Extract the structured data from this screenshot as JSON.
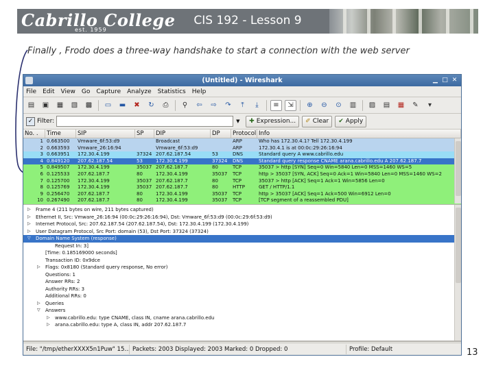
{
  "slide": {
    "logo_text": "Cabrillo College",
    "logo_est": "est. 1959",
    "title": "CIS 192 - Lesson 9",
    "caption": "Finally , Frodo does a three-way handshake to start a connection with the web server",
    "page_number": "13"
  },
  "window": {
    "title": "(Untitled) - Wireshark"
  },
  "menu": [
    "File",
    "Edit",
    "View",
    "Go",
    "Capture",
    "Analyze",
    "Statistics",
    "Help"
  ],
  "toolbar_icons": [
    "interfaces-icon",
    "start-icon",
    "stop-icon",
    "restart-icon",
    "options-icon",
    "open-icon",
    "save-icon",
    "close-icon",
    "reload-icon",
    "print-icon",
    "find-icon",
    "back-icon",
    "forward-icon",
    "goto-icon",
    "top-icon",
    "bottom-icon",
    "colorize-icon",
    "autoscroll-icon",
    "zoom-in-icon",
    "zoom-out-icon",
    "zoom-normal-icon",
    "resize-columns-icon",
    "capture-filters-icon",
    "display-filters-icon",
    "coloring-rules-icon",
    "preferences-icon",
    "help-icon"
  ],
  "filter": {
    "label": "Filter:",
    "value": "",
    "expression_label": "Expression...",
    "clear_label": "Clear",
    "apply_label": "Apply"
  },
  "packet_list": {
    "columns": [
      "No. .",
      "Time",
      "SIP",
      "SP",
      "DIP",
      "DP",
      "Protocol",
      "Info"
    ],
    "selected_index": 3,
    "rows": [
      {
        "no": "1",
        "time": "0.663500",
        "src": "Vmware_6f:53:d9",
        "sp": "",
        "dip": "Broadcast",
        "dp": "",
        "proto": "ARP",
        "info": "Who has 172.30.4.1? Tell 172.30.4.199",
        "color": "#b9d4ee"
      },
      {
        "no": "2",
        "time": "0.663593",
        "src": "Vmware_26:16:94",
        "sp": "",
        "dip": "Vmware_6f:53:d9",
        "dp": "",
        "proto": "ARP",
        "info": "172.30.4.1 is at 00:0c:29:26:16:94",
        "color": "#b9d4ee"
      },
      {
        "no": "3",
        "time": "0.663951",
        "src": "172.30.4.199",
        "sp": "37324",
        "dip": "207.62.187.54",
        "dp": "53",
        "proto": "DNS",
        "info": "Standard query A www.cabrillo.edu",
        "color": "#99ddf6"
      },
      {
        "no": "4",
        "time": "0.849120",
        "src": "207.62.187.54",
        "sp": "53",
        "dip": "172.30.4.199",
        "dp": "37324",
        "proto": "DNS",
        "info": "Standard query response CNAME arana.cabrillo.edu A 207.62.187.7",
        "color": "#3874c8"
      },
      {
        "no": "5",
        "time": "0.849507",
        "src": "172.30.4.199",
        "sp": "35037",
        "dip": "207.62.187.7",
        "dp": "80",
        "proto": "TCP",
        "info": "35037 > http [SYN] Seq=0 Win=5840 Len=0 MSS=1460 WS=5",
        "color": "#8ff07a"
      },
      {
        "no": "6",
        "time": "0.125533",
        "src": "207.62.187.7",
        "sp": "80",
        "dip": "172.30.4.199",
        "dp": "35037",
        "proto": "TCP",
        "info": "http > 35037 [SYN, ACK] Seq=0 Ack=1 Win=5840 Len=0 MSS=1460 WS=2",
        "color": "#8ff07a"
      },
      {
        "no": "7",
        "time": "0.125700",
        "src": "172.30.4.199",
        "sp": "35037",
        "dip": "207.62.187.7",
        "dp": "80",
        "proto": "TCP",
        "info": "35037 > http [ACK] Seq=1 Ack=1 Win=5856 Len=0",
        "color": "#8ff07a"
      },
      {
        "no": "8",
        "time": "0.125769",
        "src": "172.30.4.199",
        "sp": "35037",
        "dip": "207.62.187.7",
        "dp": "80",
        "proto": "HTTP",
        "info": "GET / HTTP/1.1",
        "color": "#8ff07a"
      },
      {
        "no": "9",
        "time": "0.256470",
        "src": "207.62.187.7",
        "sp": "80",
        "dip": "172.30.4.199",
        "dp": "35037",
        "proto": "TCP",
        "info": "http > 35037 [ACK] Seq=1 Ack=500 Win=6912 Len=0",
        "color": "#8ff07a"
      },
      {
        "no": "10",
        "time": "0.267490",
        "src": "207.62.187.7",
        "sp": "80",
        "dip": "172.30.4.199",
        "dp": "35037",
        "proto": "TCP",
        "info": "[TCP segment of a reassembled PDU]",
        "color": "#8ff07a"
      }
    ]
  },
  "details": [
    {
      "indent": 0,
      "tri": "▷",
      "text": "Frame 4 (211 bytes on wire, 211 bytes captured)"
    },
    {
      "indent": 0,
      "tri": "▷",
      "text": "Ethernet II, Src: Vmware_26:16:94 (00:0c:29:26:16:94), Dst: Vmware_6f:53:d9 (00:0c:29:6f:53:d9)"
    },
    {
      "indent": 0,
      "tri": "▷",
      "text": "Internet Protocol, Src: 207.62.187.54 (207.62.187.54), Dst: 172.30.4.199 (172.30.4.199)"
    },
    {
      "indent": 0,
      "tri": "▷",
      "text": "User Datagram Protocol, Src Port: domain (53), Dst Port: 37324 (37324)"
    },
    {
      "indent": 0,
      "tri": "▽",
      "text": "Domain Name System (response)",
      "sel": true
    },
    {
      "indent": 2,
      "tri": "",
      "text": "Request In: 3]"
    },
    {
      "indent": 1,
      "tri": "",
      "text": "[Time: 0.185169000 seconds]"
    },
    {
      "indent": 1,
      "tri": "",
      "text": "Transaction ID: 0x9dce"
    },
    {
      "indent": 1,
      "tri": "▷",
      "text": "Flags: 0x8180 (Standard query response, No error)"
    },
    {
      "indent": 1,
      "tri": "",
      "text": "Questions: 1"
    },
    {
      "indent": 1,
      "tri": "",
      "text": "Answer RRs: 2"
    },
    {
      "indent": 1,
      "tri": "",
      "text": "Authority RRs: 3"
    },
    {
      "indent": 1,
      "tri": "",
      "text": "Additional RRs: 0"
    },
    {
      "indent": 1,
      "tri": "▷",
      "text": "Queries"
    },
    {
      "indent": 1,
      "tri": "▽",
      "text": "Answers"
    },
    {
      "indent": 2,
      "tri": "▷",
      "text": "www.cabrillo.edu: type CNAME, class IN, cname arana.cabrillo.edu"
    },
    {
      "indent": 2,
      "tri": "▷",
      "text": "arana.cabrillo.edu: type A, class IN, addr 207.62.187.7"
    }
  ],
  "status": {
    "file": "File: \"/tmp/etherXXXX5n1Puw\" 15...",
    "packets": "Packets: 2003 Displayed: 2003 Marked: 0 Dropped: 0",
    "profile": "Profile: Default"
  },
  "colors": {
    "tcp_green": "#8ff07a",
    "selected_blue": "#3874c8",
    "arp_blue": "#b9d4ee",
    "dns_blue": "#99ddf6"
  }
}
